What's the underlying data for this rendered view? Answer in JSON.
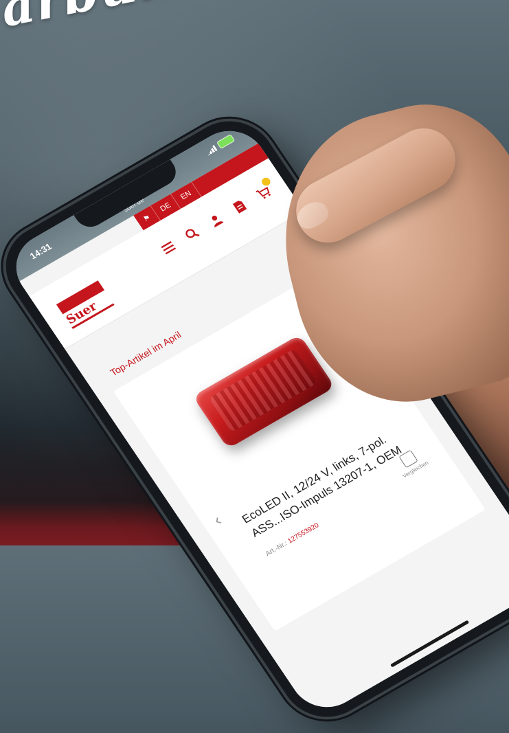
{
  "headline": "arbun",
  "status": {
    "time": "14:31",
    "url": "suer.de"
  },
  "lang_switch": [
    "DE",
    "EN"
  ],
  "header": {
    "logo_text": "Suer",
    "icons": [
      "menu-icon",
      "search-icon",
      "user-icon",
      "document-icon",
      "cart-icon"
    ]
  },
  "section": {
    "title": "Top-Artikel im April"
  },
  "product": {
    "title": "EcoLED II, 12/24 V, links, 7-pol. ASS...ISO-Impuls 13207-1, OEM",
    "article_label": "Art.-Nr.:",
    "article_number": "127553920",
    "compare_label": "Vergleichen"
  },
  "colors": {
    "brand_red": "#c4161c",
    "battery_green": "#7de05a",
    "cart_badge": "#f2c21b"
  }
}
